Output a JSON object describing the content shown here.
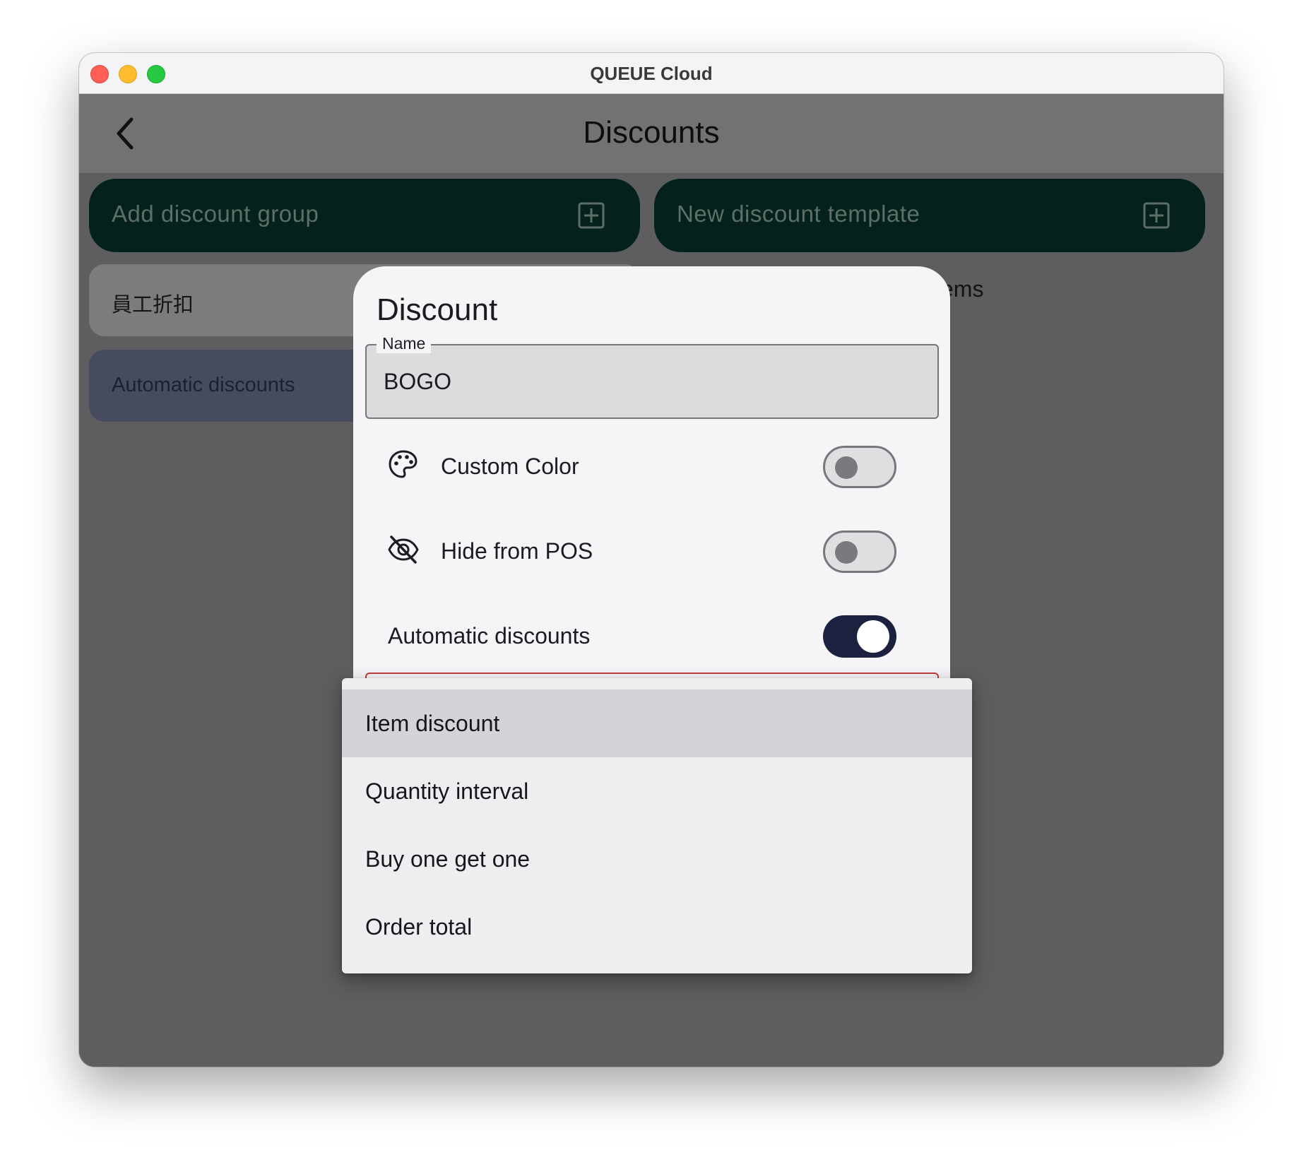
{
  "window": {
    "title": "QUEUE Cloud"
  },
  "appbar": {
    "title": "Discounts",
    "back_icon": "chevron-left-icon"
  },
  "actions": {
    "add_group_label": "Add discount group",
    "new_template_label": "New discount template",
    "plus_icon": "plus-square-icon"
  },
  "list": {
    "items": [
      {
        "label": "員工折扣"
      },
      {
        "label": "Automatic discounts"
      }
    ],
    "right_panel_peek": "ems"
  },
  "dialog": {
    "title": "Discount",
    "name_field": {
      "label": "Name",
      "value": "BOGO"
    },
    "custom_color": {
      "label": "Custom Color",
      "icon": "palette-icon",
      "enabled": false
    },
    "hide_from_pos": {
      "label": "Hide from POS",
      "icon": "eye-off-icon",
      "enabled": false
    },
    "automatic_discounts": {
      "label": "Automatic discounts",
      "enabled": true
    }
  },
  "menu": {
    "options": [
      {
        "label": "Item discount",
        "highlighted": true
      },
      {
        "label": "Quantity interval",
        "highlighted": false
      },
      {
        "label": "Buy one get one",
        "highlighted": false
      },
      {
        "label": "Order total",
        "highlighted": false
      }
    ]
  },
  "colors": {
    "button_bg": "#04211b",
    "toggle_on": "#1d2140",
    "error_outline": "#c43a3a",
    "selected_list_item": "#474b5e"
  }
}
